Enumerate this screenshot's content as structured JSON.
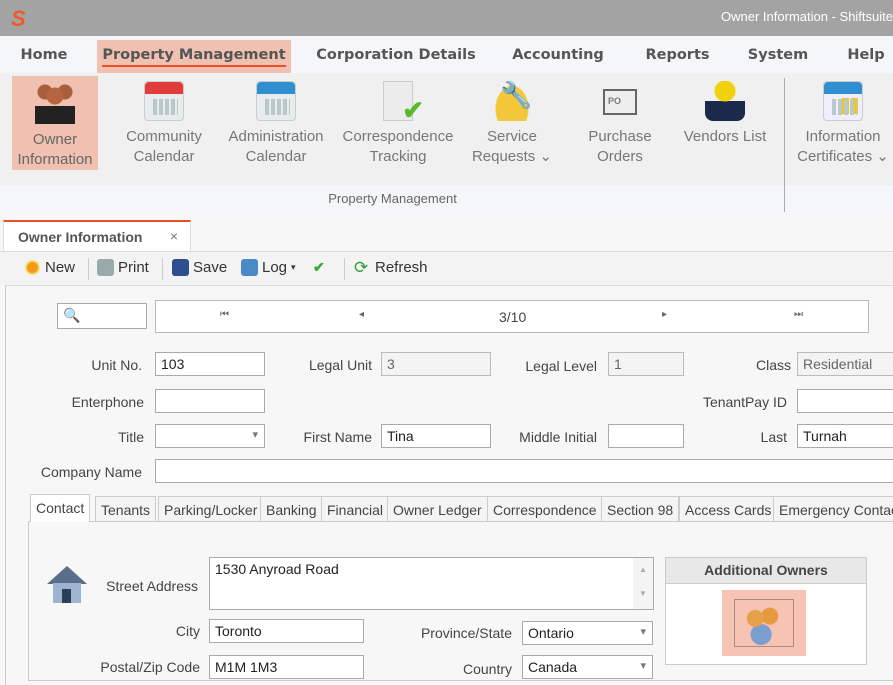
{
  "window": {
    "title": "Owner Information - Shiftsuite"
  },
  "menu": [
    {
      "label": "Home"
    },
    {
      "label": "Property Management",
      "active": true
    },
    {
      "label": "Corporation Details"
    },
    {
      "label": "Accounting"
    },
    {
      "label": "Reports"
    },
    {
      "label": "System"
    },
    {
      "label": "Help"
    }
  ],
  "ribbon": {
    "group_label": "Property Management",
    "buttons": [
      {
        "line1": "Owner",
        "line2": "Information",
        "icon": "people-icon"
      },
      {
        "line1": "Community",
        "line2": "Calendar",
        "icon": "calendar-red-icon"
      },
      {
        "line1": "Administration",
        "line2": "Calendar",
        "icon": "calendar-blue-icon"
      },
      {
        "line1": "Correspondence",
        "line2": "Tracking",
        "icon": "checklist-icon"
      },
      {
        "line1": "Service",
        "line2": "Requests ⌄",
        "icon": "hardhat-wrench-icon"
      },
      {
        "line1": "Purchase",
        "line2": "Orders",
        "icon": "purchase-order-icon"
      },
      {
        "line1": "Vendors List",
        "line2": "",
        "icon": "worker-icon"
      },
      {
        "line1": "Information",
        "line2": "Certificates ⌄",
        "icon": "certificates-icon"
      }
    ]
  },
  "doc_tab": {
    "label": "Owner Information",
    "close": "×"
  },
  "toolbar": {
    "new": "New",
    "print": "Print",
    "save": "Save",
    "log": "Log",
    "refresh": "Refresh"
  },
  "nav": {
    "first": "⏮",
    "prev": "◂",
    "position": "3/10",
    "next": "▸",
    "last": "⏭"
  },
  "form": {
    "unit_no": {
      "label": "Unit No.",
      "value": "103"
    },
    "legal_unit": {
      "label": "Legal Unit",
      "value": "3"
    },
    "legal_level": {
      "label": "Legal Level",
      "value": "1"
    },
    "class": {
      "label": "Class",
      "value": "Residential"
    },
    "enterphone": {
      "label": "Enterphone",
      "value": ""
    },
    "tenantpay": {
      "label": "TenantPay ID",
      "value": ""
    },
    "title": {
      "label": "Title",
      "value": ""
    },
    "first_name": {
      "label": "First Name",
      "value": "Tina"
    },
    "middle_initial": {
      "label": "Middle Initial",
      "value": ""
    },
    "last": {
      "label": "Last",
      "value": "Turnah"
    },
    "company": {
      "label": "Company Name",
      "value": ""
    }
  },
  "subtabs": [
    "Contact",
    "Tenants",
    "Parking/Locker",
    "Banking",
    "Financial",
    "Owner Ledger",
    "Correspondence",
    "Section 98",
    "Access Cards",
    "Emergency Contacts"
  ],
  "contact": {
    "street": {
      "label": "Street Address",
      "value": "1530 Anyroad Road"
    },
    "city": {
      "label": "City",
      "value": "Toronto"
    },
    "province": {
      "label": "Province/State",
      "value": "Ontario"
    },
    "postal": {
      "label": "Postal/Zip Code",
      "value": "M1M 1M3"
    },
    "country": {
      "label": "Country",
      "value": "Canada"
    },
    "additional_owners": "Additional Owners"
  }
}
